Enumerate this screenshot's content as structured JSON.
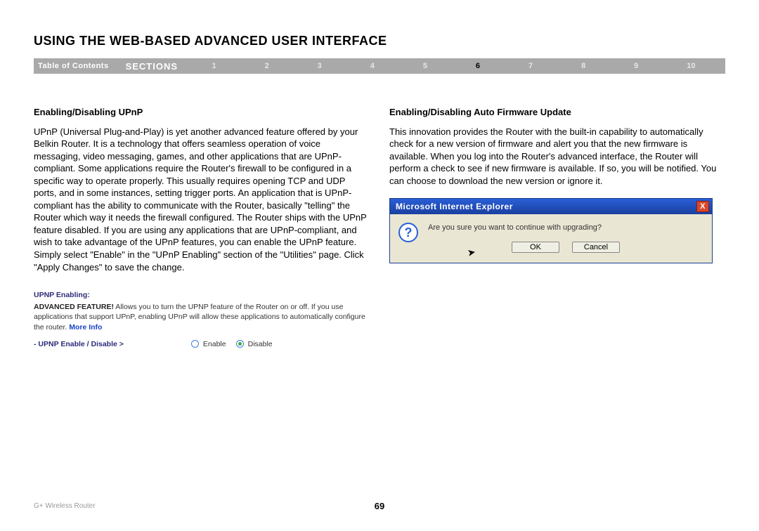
{
  "header": {
    "title": "USING THE WEB-BASED ADVANCED USER INTERFACE"
  },
  "nav": {
    "toc": "Table of Contents",
    "sections_label": "SECTIONS",
    "items": [
      "1",
      "2",
      "3",
      "4",
      "5",
      "6",
      "7",
      "8",
      "9",
      "10"
    ],
    "active_index": 5
  },
  "left": {
    "heading": "Enabling/Disabling UPnP",
    "body": "UPnP (Universal Plug-and-Play) is yet another advanced feature offered by your Belkin Router. It is a technology that offers seamless operation of voice messaging, video messaging, games, and other applications that are UPnP-compliant. Some applications require the Router's firewall to be configured in a specific way to operate properly. This usually requires opening TCP and UDP ports, and in some instances, setting trigger ports. An application that is UPnP-compliant has the ability to communicate with the Router, basically \"telling\" the Router which way it needs the firewall configured. The Router ships with the UPnP feature disabled. If you are using any applications that are UPnP-compliant, and wish to take advantage of the UPnP features, you can enable the UPnP feature. Simply select \"Enable\" in the \"UPnP Enabling\" section of the \"Utilities\" page. Click \"Apply Changes\" to save the change."
  },
  "upnp_ui": {
    "title": "UPNP Enabling:",
    "feature_label": "ADVANCED FEATURE!",
    "desc": " Allows you to turn the UPNP feature of the Router on or off. If you use applications that support UPnP, enabling UPnP will allow these applications to automatically configure the router. ",
    "more": "More Info",
    "toggle_label": "- UPNP Enable / Disable >",
    "enable": "Enable",
    "disable": "Disable"
  },
  "right": {
    "heading": "Enabling/Disabling Auto Firmware Update",
    "body": "This innovation provides the Router with the built-in capability to automatically check for a new version of firmware and alert you that the new firmware is available. When you log into the Router's advanced interface, the Router will perform a check to see if new firmware is available. If so, you will be notified. You can choose to download the new version or ignore it."
  },
  "dialog": {
    "title": "Microsoft Internet Explorer",
    "close": "X",
    "icon": "?",
    "message": "Are you sure you want to continue with upgrading?",
    "ok": "OK",
    "cancel": "Cancel"
  },
  "footer": {
    "product": "G+ Wireless Router",
    "page": "69"
  }
}
